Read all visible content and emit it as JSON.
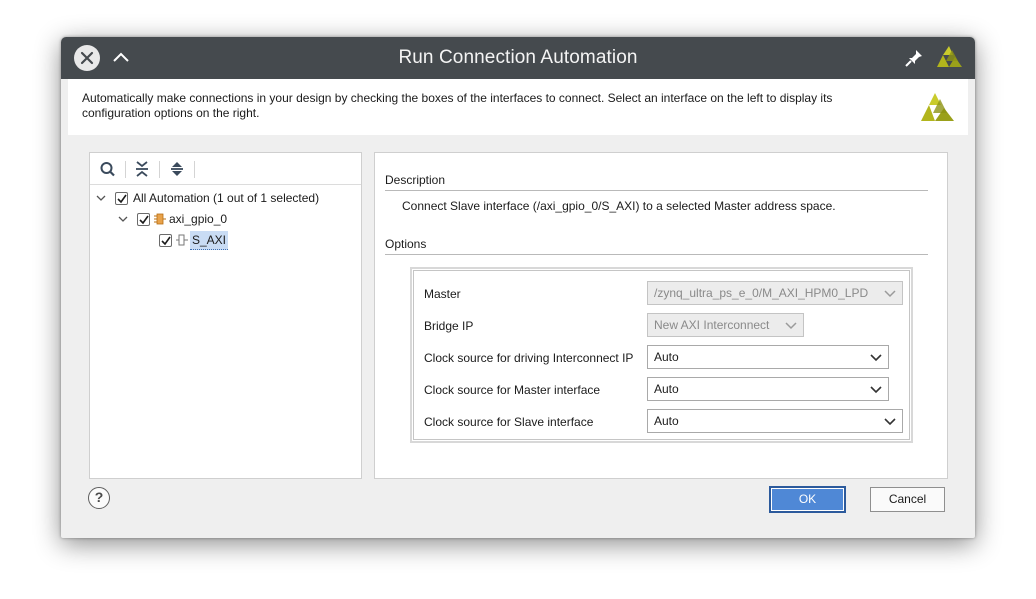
{
  "window": {
    "title": "Run Connection Automation"
  },
  "banner": {
    "description": "Automatically make connections in your design by checking the boxes of the interfaces to connect. Select an interface on the left to display its configuration options on the right."
  },
  "tree": {
    "toolbar_icons": [
      "search-icon",
      "collapse-all-icon",
      "expand-all-icon"
    ],
    "items": [
      {
        "label": "All Automation (1 out of 1 selected)",
        "checked": true,
        "expanded": true,
        "icon": ""
      },
      {
        "label": "axi_gpio_0",
        "checked": true,
        "expanded": true,
        "icon": "ip-block-icon"
      },
      {
        "label": "S_AXI",
        "checked": true,
        "selected": true,
        "icon": "interface-pin-icon"
      }
    ]
  },
  "details": {
    "description_header": "Description",
    "description_text": "Connect Slave interface (/axi_gpio_0/S_AXI) to a selected Master address space.",
    "options_header": "Options",
    "options": [
      {
        "label": "Master",
        "value": "/zynq_ultra_ps_e_0/M_AXI_HPM0_LPD",
        "enabled": false
      },
      {
        "label": "Bridge IP",
        "value": "New AXI Interconnect",
        "enabled": false
      },
      {
        "label": "Clock source for driving Interconnect IP",
        "value": "Auto",
        "enabled": true
      },
      {
        "label": "Clock source for Master interface",
        "value": "Auto",
        "enabled": true
      },
      {
        "label": "Clock source for Slave interface",
        "value": "Auto",
        "enabled": true
      }
    ]
  },
  "footer": {
    "help_label": "?",
    "ok_label": "OK",
    "cancel_label": "Cancel"
  },
  "colors": {
    "titlebar": "#454a4e",
    "accent": "#4f88d6",
    "logo_green": "#b2b51c",
    "selection": "#c9dcf4"
  }
}
